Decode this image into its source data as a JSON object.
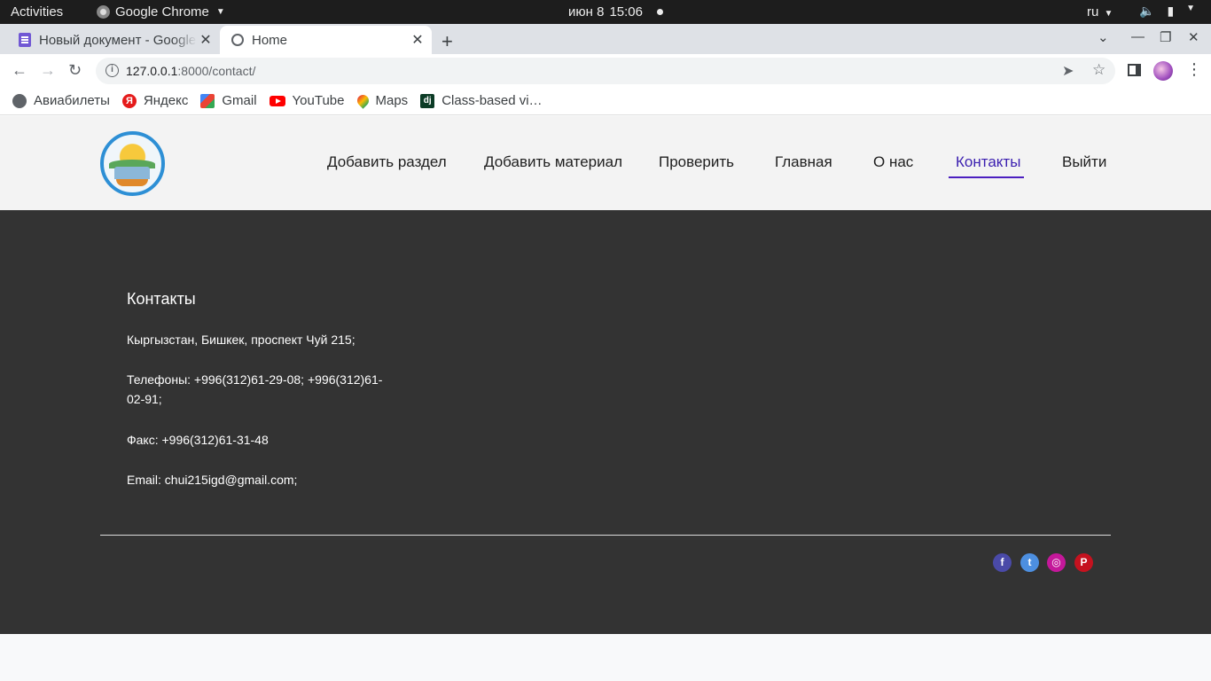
{
  "system": {
    "activities": "Activities",
    "app_name": "Google Chrome",
    "date": "июн 8",
    "time": "15:06",
    "lang": "ru"
  },
  "browser": {
    "tabs": [
      {
        "title": "Новый документ - Google",
        "icon": "google-docs-icon"
      },
      {
        "title": "Home",
        "icon": "globe-icon"
      }
    ],
    "url_host": "127.0.0.1",
    "url_path": ":8000/contact/",
    "bookmarks": [
      {
        "label": "Авиабилеты",
        "icon": "globe-icon"
      },
      {
        "label": "Яндекс",
        "icon": "yandex-icon"
      },
      {
        "label": "Gmail",
        "icon": "gmail-icon"
      },
      {
        "label": "YouTube",
        "icon": "youtube-icon"
      },
      {
        "label": "Maps",
        "icon": "maps-icon"
      },
      {
        "label": "Class-based vi…",
        "icon": "django-icon"
      }
    ]
  },
  "site": {
    "nav": [
      {
        "label": "Добавить раздел"
      },
      {
        "label": "Добавить материал"
      },
      {
        "label": "Проверить"
      },
      {
        "label": "Главная"
      },
      {
        "label": "О нас"
      },
      {
        "label": "Контакты",
        "active": true
      },
      {
        "label": "Выйти"
      }
    ],
    "accent": "#4b1fc0",
    "contacts": {
      "title": "Контакты",
      "address": "Кыргызстан, Бишкек, проспект Чуй 215;",
      "phones": "Телефоны: +996(312)61-29-08; +996(312)61-02-91;",
      "fax": "Факс: +996(312)61-31-48",
      "email": "Email: chui215igd@gmail.com;"
    },
    "social": [
      {
        "name": "facebook-icon",
        "glyph": "f"
      },
      {
        "name": "twitter-icon",
        "glyph": "t"
      },
      {
        "name": "instagram-icon",
        "glyph": "◎"
      },
      {
        "name": "pinterest-icon",
        "glyph": "P"
      }
    ]
  }
}
